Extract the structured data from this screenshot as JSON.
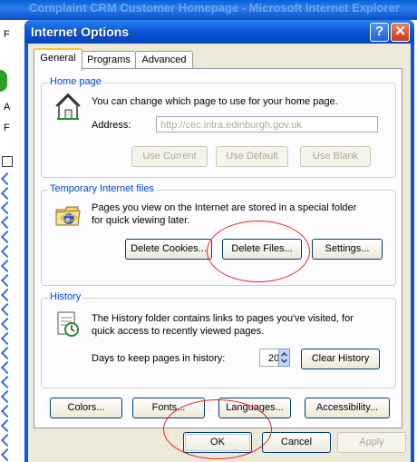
{
  "background": {
    "window_title": "Complaint CRM Customer Homepage - Microsoft Internet Explorer",
    "left_glyphs": [
      "F",
      "A",
      "F"
    ]
  },
  "dialog": {
    "title": "Internet Options",
    "help_label": "?",
    "close_label": "✕",
    "tabs": [
      {
        "label": "General",
        "active": true
      },
      {
        "label": "Programs",
        "active": false
      },
      {
        "label": "Advanced",
        "active": false
      }
    ],
    "home_page": {
      "legend": "Home page",
      "description": "You can change which page to use for your home page.",
      "address_label": "Address:",
      "address_value": "http://cec.intra.edinburgh.gov.uk",
      "use_current": "Use Current",
      "use_default": "Use Default",
      "use_blank": "Use Blank"
    },
    "temp_files": {
      "legend": "Temporary Internet files",
      "description_1": "Pages you view on the Internet are stored in a special folder",
      "description_2": "for quick viewing later.",
      "delete_cookies": "Delete Cookies...",
      "delete_files": "Delete Files...",
      "settings": "Settings..."
    },
    "history": {
      "legend": "History",
      "description_1": "The History folder contains links to pages you've visited, for",
      "description_2": "quick access to recently viewed pages.",
      "days_label": "Days to keep pages in history:",
      "days_value": "20",
      "clear_history": "Clear History"
    },
    "bottom_buttons": {
      "colors": "Colors...",
      "fonts": "Fonts...",
      "languages": "Languages...",
      "accessibility": "Accessibility..."
    },
    "footer": {
      "ok": "OK",
      "cancel": "Cancel",
      "apply": "Apply"
    }
  },
  "colors": {
    "titlebar_blue": "#0a5ad9",
    "legend_blue": "#0046d5",
    "annotation_red": "#e1261c",
    "dialog_face": "#ece9d8"
  }
}
